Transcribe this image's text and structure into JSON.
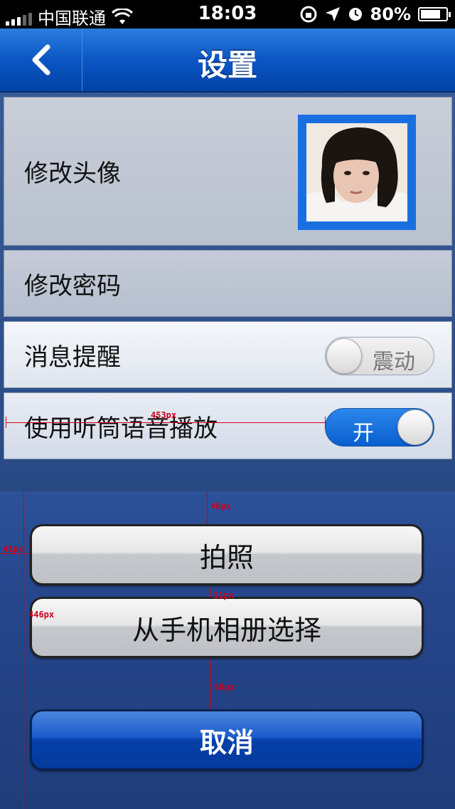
{
  "status_bar": {
    "carrier": "中国联通",
    "time": "18:03",
    "battery": "80%",
    "battery_level": 0.8,
    "icons": [
      "signal-icon",
      "wifi-icon",
      "rotation-lock-icon",
      "location-icon",
      "alarm-icon",
      "battery-icon"
    ]
  },
  "nav": {
    "title": "设置",
    "back_icon": "chevron-left-icon"
  },
  "settings": {
    "avatar_label": "修改头像",
    "password_label": "修改密码",
    "notify_label": "消息提醒",
    "notify_toggle": {
      "state": "off",
      "text": "震动"
    },
    "earpiece_label": "使用听筒语音播放",
    "earpiece_toggle": {
      "state": "on",
      "text": "开"
    }
  },
  "annotations": {
    "width_453": "453px",
    "gap_46": "46px",
    "left_41": "41px",
    "height_446": "446px",
    "gap_11": "11px",
    "gap_68": "68px"
  },
  "action_sheet": {
    "take_photo": "拍照",
    "choose_album": "从手机相册选择",
    "cancel": "取消"
  },
  "colors": {
    "nav_blue": "#0b56c4",
    "avatar_border": "#1a6fe0",
    "annotation_red": "#d0001a"
  }
}
